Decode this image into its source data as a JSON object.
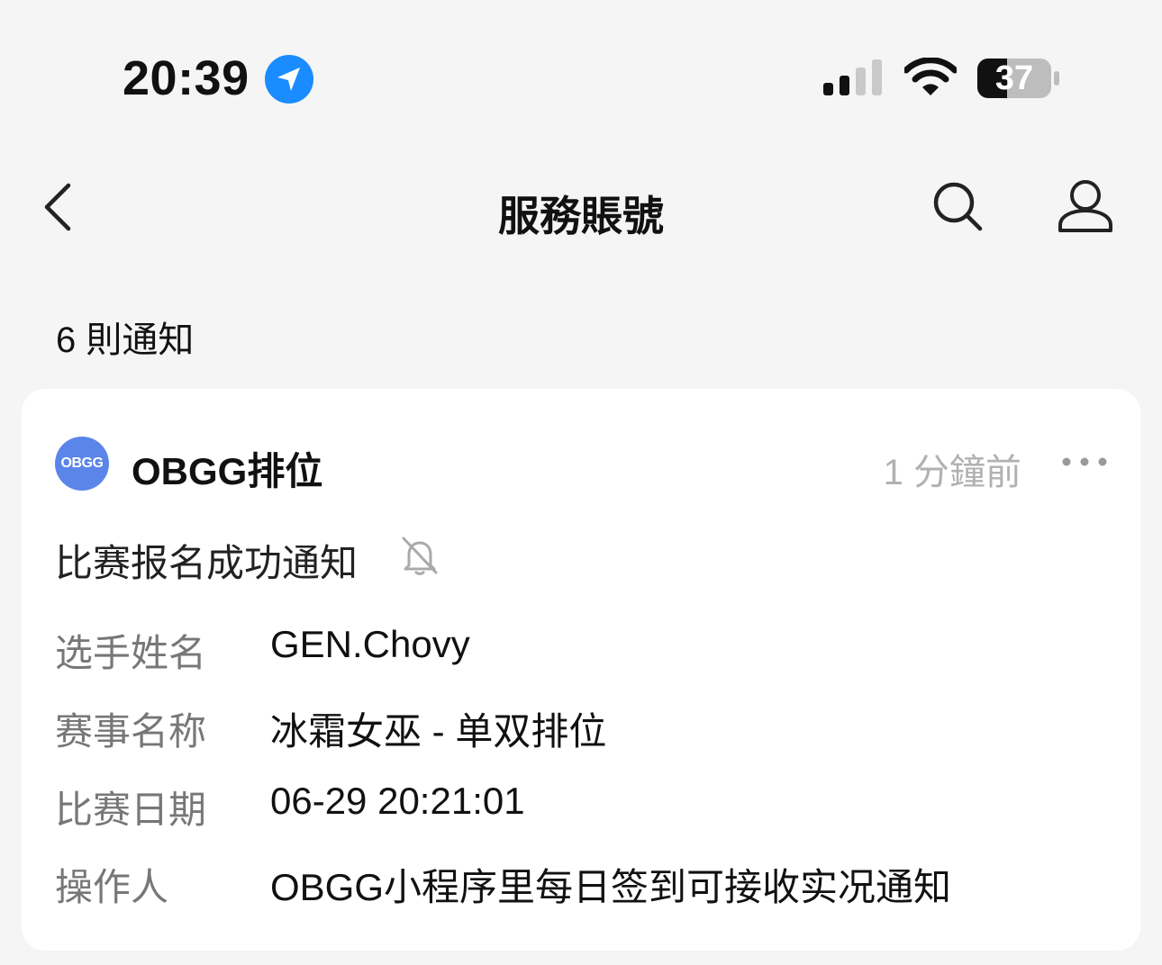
{
  "status_bar": {
    "time": "20:39",
    "battery": "37"
  },
  "nav": {
    "title": "服務賬號"
  },
  "notification_count": "6 則通知",
  "card": {
    "avatar_text": "OBGG",
    "sender": "OBGG排位",
    "time_ago": "1 分鐘前",
    "title": "比赛报名成功通知",
    "accent": "#5b85e8",
    "rows": [
      {
        "label": "选手姓名",
        "value": "GEN.Chovy"
      },
      {
        "label": "赛事名称",
        "value": "冰霜女巫 - 单双排位"
      },
      {
        "label": "比赛日期",
        "value": "06-29 20:21:01"
      },
      {
        "label": "操作人",
        "value": "OBGG小程序里每日签到可接收实况通知"
      }
    ]
  },
  "icons": [
    "location-arrow-icon",
    "signal-icon",
    "wifi-icon",
    "battery-icon",
    "back-chevron-icon",
    "search-icon",
    "user-icon",
    "more-icon",
    "bell-muted-icon"
  ]
}
